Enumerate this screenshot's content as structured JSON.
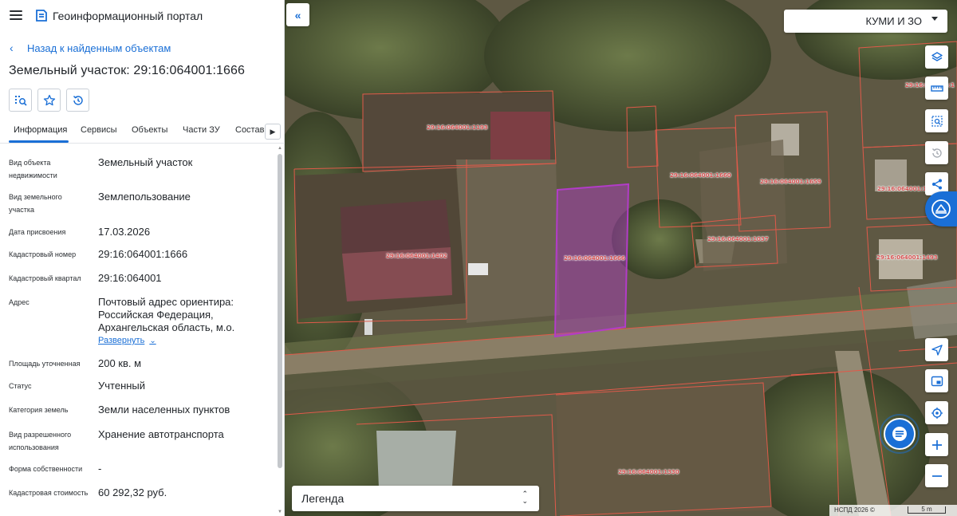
{
  "header": {
    "portal_title": "Геоинформационный портал",
    "menu_icon": "menu-icon",
    "logo_icon": "portal-logo-icon"
  },
  "back_link": "Назад к найденным объектам",
  "object_title": "Земельный участок: 29:16:064001:1666",
  "actions": [
    {
      "icon": "map-search-icon"
    },
    {
      "icon": "star-icon"
    },
    {
      "icon": "history-icon"
    }
  ],
  "tabs": [
    {
      "label": "Информация",
      "active": true
    },
    {
      "label": "Сервисы"
    },
    {
      "label": "Объекты"
    },
    {
      "label": "Части ЗУ"
    },
    {
      "label": "Состав"
    }
  ],
  "info": {
    "type_key": "Вид объекта недвижимости",
    "type_val": "Земельный участок",
    "landtype_key": "Вид земельного участка",
    "landtype_val": "Землепользование",
    "date_key": "Дата присвоения",
    "date_val": "17.03.2026",
    "cadnum_key": "Кадастровый номер",
    "cadnum_val": "29:16:064001:1666",
    "quarter_key": "Кадастровый квартал",
    "quarter_val": "29:16:064001",
    "address_key": "Адрес",
    "address_val": "Почтовый адрес ориентира: Российская Федерация, Архангельская область, м.о.",
    "expand_label": "Развернуть",
    "area_key": "Площадь уточненная",
    "area_val": "200 кв. м",
    "status_key": "Статус",
    "status_val": "Учтенный",
    "category_key": "Категория земель",
    "category_val": "Земли населенных пунктов",
    "use_key": "Вид разрешенного использования",
    "use_val": "Хранение автотранспорта",
    "ownership_key": "Форма собственности",
    "ownership_val": "-",
    "cost_key": "Кадастровая стоимость",
    "cost_val": "60 292,32 руб."
  },
  "map": {
    "org_select": "КУМИ И ЗО",
    "legend": "Легенда",
    "copyright": "НСПД 2026 ©",
    "scale": "5 m",
    "parcel_labels": [
      "29:16:064001:1193",
      "29:16:064001:1660",
      "29:16:064001:1659",
      "29:16:064001:1",
      "29:16:064001:1666",
      "29:16:064001:1402",
      "29:16:064001:1037",
      "29:16:064001:1493",
      "29:16:064001:1",
      "29:16:064001:1330"
    ],
    "right_controls": [
      "layers-icon",
      "ruler-icon",
      "select-area-icon",
      "history-icon",
      "share-icon",
      "navigate-icon",
      "minimap-icon",
      "locate-icon",
      "zoom-in-icon",
      "zoom-out-icon"
    ],
    "colors": {
      "accent": "#1a6fd6",
      "parcel_border": "#e05a4a",
      "selected_parcel": "#b23cc8"
    }
  }
}
